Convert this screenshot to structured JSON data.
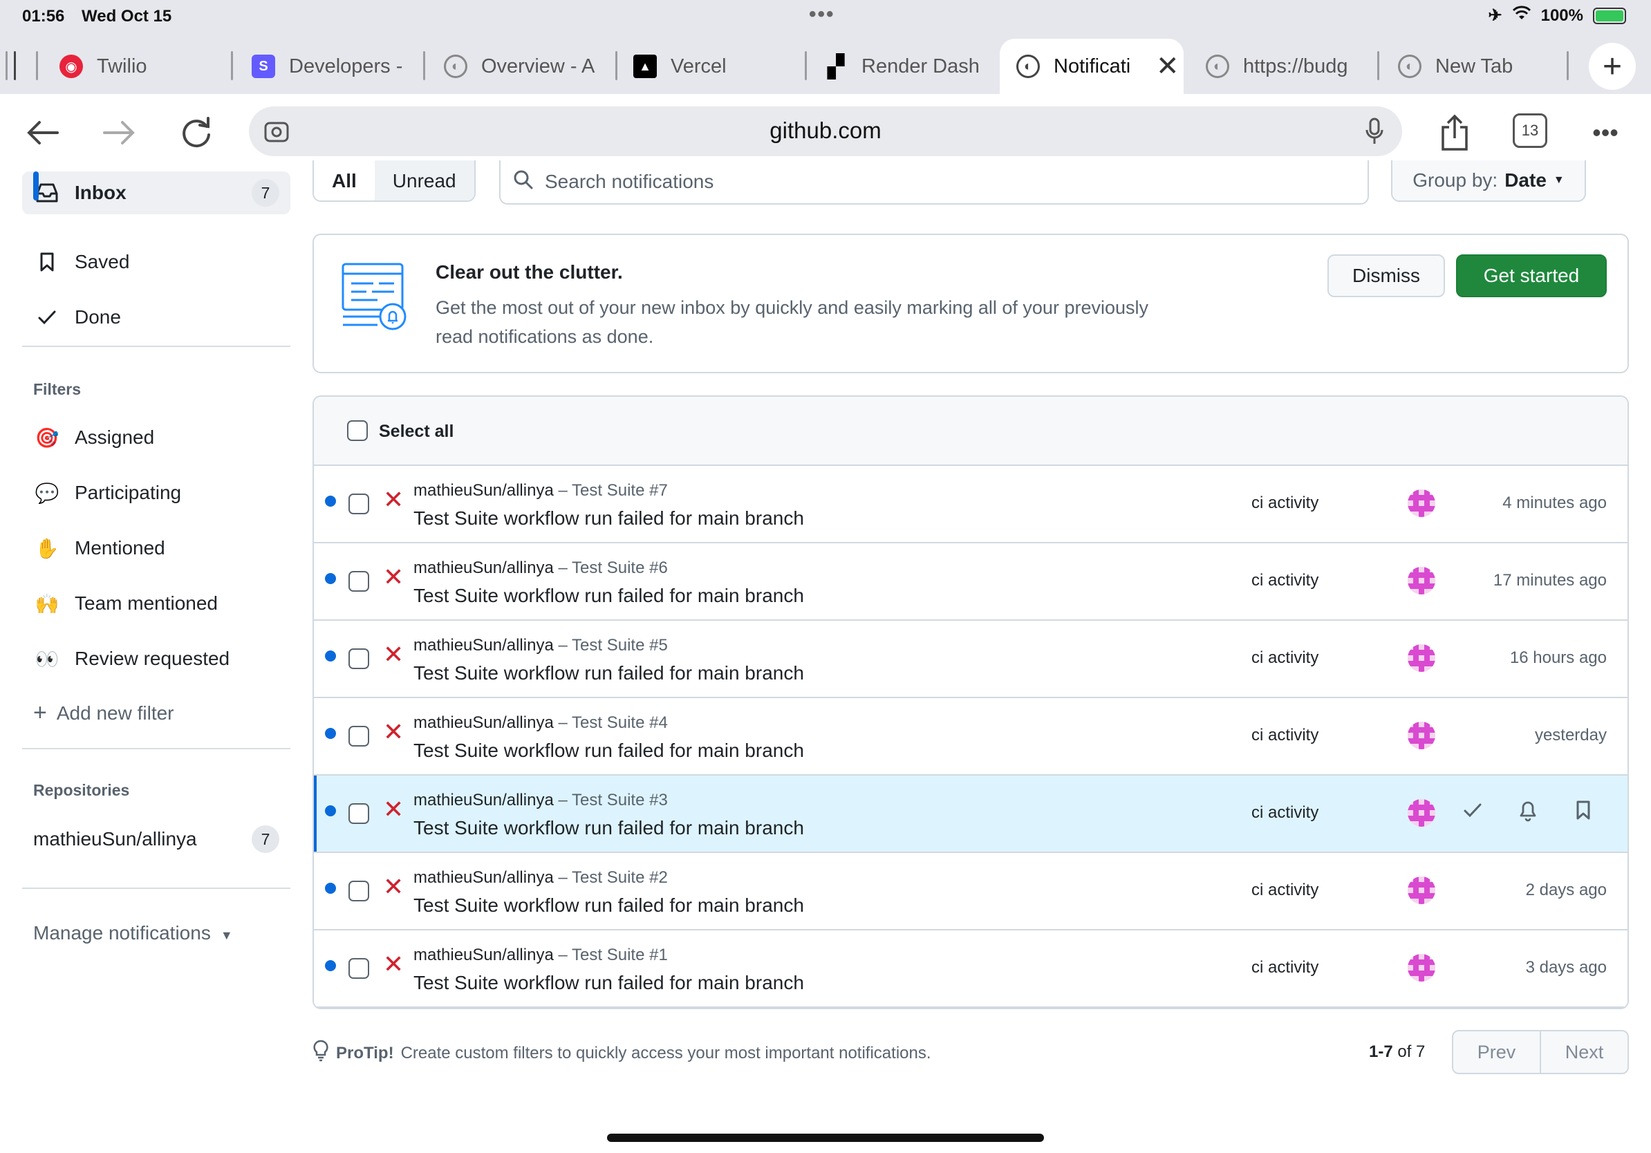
{
  "status": {
    "time": "01:56",
    "date": "Wed Oct 15",
    "battery": "100%"
  },
  "tabs": [
    {
      "label": "Twilio",
      "icon": "twilio-icon"
    },
    {
      "label": "Developers -",
      "icon": "stripe-s-icon"
    },
    {
      "label": "Overview - A",
      "icon": "globe-icon"
    },
    {
      "label": "Vercel",
      "icon": "vercel-triangle-icon"
    },
    {
      "label": "Render Dash",
      "icon": "render-icon"
    },
    {
      "label": "Notificati",
      "icon": "globe-icon",
      "active": true
    },
    {
      "label": "https://budg",
      "icon": "globe-icon"
    },
    {
      "label": "New Tab",
      "icon": "globe-icon"
    }
  ],
  "toolbar": {
    "url": "github.com",
    "tab_count": "13"
  },
  "sidebar": {
    "inbox": {
      "label": "Inbox",
      "count": "7"
    },
    "saved": "Saved",
    "done": "Done",
    "filters_heading": "Filters",
    "filters": [
      {
        "label": "Assigned",
        "icon": "🎯"
      },
      {
        "label": "Participating",
        "icon": "💬"
      },
      {
        "label": "Mentioned",
        "icon": "✋"
      },
      {
        "label": "Team mentioned",
        "icon": "🙌"
      },
      {
        "label": "Review requested",
        "icon": "👀"
      }
    ],
    "add_filter": "Add new filter",
    "repos_heading": "Repositories",
    "repos": [
      {
        "label": "mathieuSun/allinya",
        "count": "7"
      }
    ],
    "manage": "Manage notifications"
  },
  "filter_bar": {
    "all": "All",
    "unread": "Unread",
    "search_placeholder": "Search notifications",
    "group_by_label": "Group by:",
    "group_by_value": "Date"
  },
  "banner": {
    "title": "Clear out the clutter.",
    "text": "Get the most out of your new inbox by quickly and easily marking all of your previously read notifications as done.",
    "dismiss": "Dismiss",
    "get_started": "Get started"
  },
  "list": {
    "select_all": "Select all",
    "rows": [
      {
        "repo": "mathieuSun/allinya",
        "sep": " – ",
        "suite": "Test Suite #7",
        "title": "Test Suite workflow run failed for main branch",
        "reason": "ci activity",
        "time": "4 minutes ago"
      },
      {
        "repo": "mathieuSun/allinya",
        "sep": " – ",
        "suite": "Test Suite #6",
        "title": "Test Suite workflow run failed for main branch",
        "reason": "ci activity",
        "time": "17 minutes ago"
      },
      {
        "repo": "mathieuSun/allinya",
        "sep": " – ",
        "suite": "Test Suite #5",
        "title": "Test Suite workflow run failed for main branch",
        "reason": "ci activity",
        "time": "16 hours ago"
      },
      {
        "repo": "mathieuSun/allinya",
        "sep": " – ",
        "suite": "Test Suite #4",
        "title": "Test Suite workflow run failed for main branch",
        "reason": "ci activity",
        "time": "yesterday"
      },
      {
        "repo": "mathieuSun/allinya",
        "sep": " – ",
        "suite": "Test Suite #3",
        "title": "Test Suite workflow run failed for main branch",
        "reason": "ci activity",
        "time": ""
      },
      {
        "repo": "mathieuSun/allinya",
        "sep": " – ",
        "suite": "Test Suite #2",
        "title": "Test Suite workflow run failed for main branch",
        "reason": "ci activity",
        "time": "2 days ago"
      },
      {
        "repo": "mathieuSun/allinya",
        "sep": " – ",
        "suite": "Test Suite #1",
        "title": "Test Suite workflow run failed for main branch",
        "reason": "ci activity",
        "time": "3 days ago"
      }
    ]
  },
  "footer": {
    "protip_label": "ProTip!",
    "protip_text": "Create custom filters to quickly access your most important notifications.",
    "range": "1-7",
    "of_total": "of 7",
    "prev": "Prev",
    "next": "Next"
  },
  "colors": {
    "accent": "#0969da",
    "primary_button": "#1f883d",
    "fail": "#cf222e",
    "hover_row": "#ddf4ff"
  }
}
